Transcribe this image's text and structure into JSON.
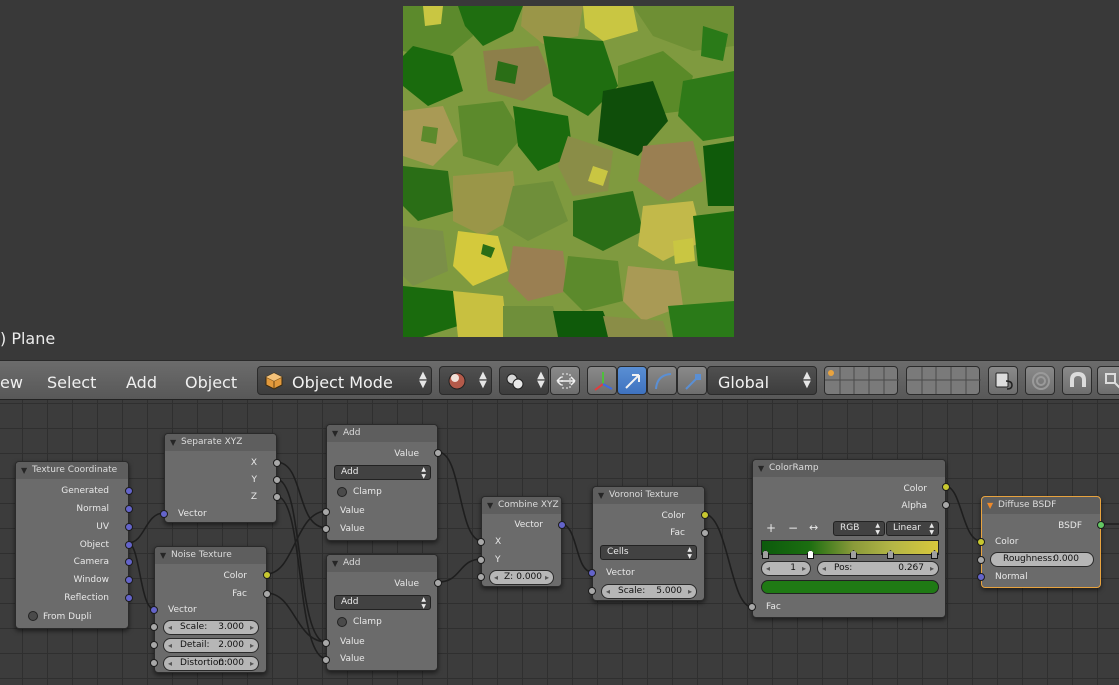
{
  "viewport": {
    "object_label": ") Plane"
  },
  "header": {
    "menu": [
      "ew",
      "Select",
      "Add",
      "Object"
    ],
    "mode": "Object Mode",
    "orientation": "Global"
  },
  "nodes": {
    "texture_coordinate": {
      "title": "Texture Coordinate",
      "outputs": [
        "Generated",
        "Normal",
        "UV",
        "Object",
        "Camera",
        "Window",
        "Reflection"
      ],
      "option": "From Dupli"
    },
    "separate_xyz": {
      "title": "Separate XYZ",
      "outputs": [
        "X",
        "Y",
        "Z"
      ],
      "input": "Vector"
    },
    "noise_texture": {
      "title": "Noise Texture",
      "outputs": [
        "Color",
        "Fac"
      ],
      "input": "Vector",
      "fields": [
        {
          "label": "Scale:",
          "value": "3.000"
        },
        {
          "label": "Detail:",
          "value": "2.000"
        },
        {
          "label": "Distortion:",
          "value": "0.000"
        }
      ]
    },
    "add_1": {
      "title": "Add",
      "output": "Value",
      "operation": "Add",
      "clamp_label": "Clamp",
      "inputs": [
        "Value",
        "Value"
      ]
    },
    "add_2": {
      "title": "Add",
      "output": "Value",
      "operation": "Add",
      "clamp_label": "Clamp",
      "inputs": [
        "Value",
        "Value"
      ]
    },
    "combine_xyz": {
      "title": "Combine XYZ",
      "output": "Vector",
      "inputs": [
        "X",
        "Y"
      ],
      "z_field": {
        "label": "Z:",
        "value": "0.000"
      }
    },
    "voronoi_texture": {
      "title": "Voronoi Texture",
      "outputs": [
        "Color",
        "Fac"
      ],
      "coloring": "Cells",
      "input": "Vector",
      "scale": {
        "label": "Scale:",
        "value": "5.000"
      }
    },
    "color_ramp": {
      "title": "ColorRamp",
      "outputs": [
        "Color",
        "Alpha"
      ],
      "add_icon": "+",
      "remove_icon": "−",
      "flip_icon": "↔",
      "color_mode": "RGB",
      "interpolation": "Linear",
      "stop_index": "1",
      "pos": {
        "label": "Pos:",
        "value": "0.267"
      },
      "input": "Fac",
      "ramp_stops": [
        0.0,
        0.267,
        0.52,
        0.74,
        1.0
      ],
      "active_color": "#1f7a14"
    },
    "diffuse_bsdf": {
      "title": "Diffuse BSDF",
      "output": "BSDF",
      "inputs": [
        "Color",
        "Normal"
      ],
      "roughness": {
        "label": "Roughness:",
        "value": "0.000"
      }
    }
  },
  "colors": {
    "socket_gray": "#a8a8a8",
    "socket_vector": "#6464ca",
    "socket_color": "#c8c830",
    "socket_shader": "#63c763",
    "selection": "#e8a33f"
  }
}
